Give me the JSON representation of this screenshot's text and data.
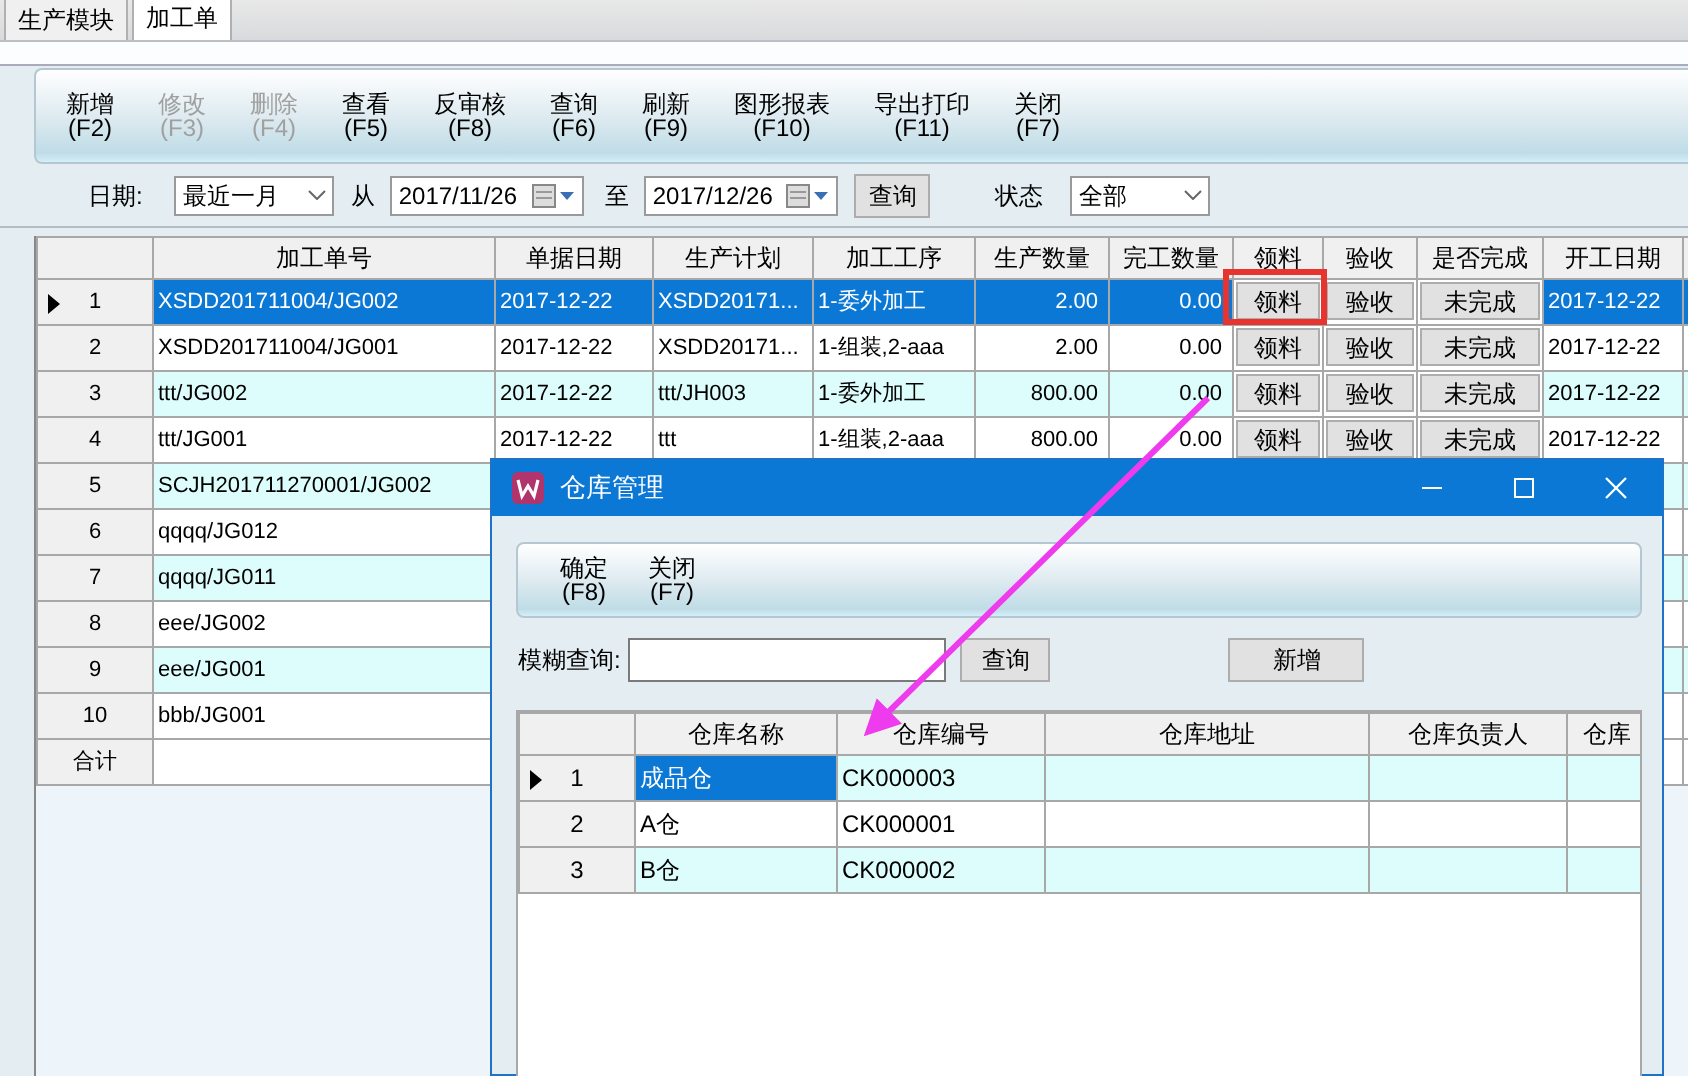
{
  "tabs": [
    {
      "label": "生产模块",
      "selected": false
    },
    {
      "label": "加工单",
      "selected": true
    }
  ],
  "toolbar": [
    {
      "label": "新增",
      "key": "(F2)",
      "disabled": false
    },
    {
      "label": "修改",
      "key": "(F3)",
      "disabled": true
    },
    {
      "label": "删除",
      "key": "(F4)",
      "disabled": true
    },
    {
      "label": "查看",
      "key": "(F5)",
      "disabled": false
    },
    {
      "label": "反审核",
      "key": "(F8)",
      "disabled": false
    },
    {
      "label": "查询",
      "key": "(F6)",
      "disabled": false
    },
    {
      "label": "刷新",
      "key": "(F9)",
      "disabled": false
    },
    {
      "label": "图形报表",
      "key": "(F10)",
      "disabled": false
    },
    {
      "label": "导出打印",
      "key": "(F11)",
      "disabled": false
    },
    {
      "label": "关闭",
      "key": "(F7)",
      "disabled": false
    }
  ],
  "filter": {
    "date_label": "日期:",
    "period": "最近一月",
    "from_label": "从",
    "from": "2017/11/26",
    "to_label": "至",
    "to": "2017/12/26",
    "query_button": "查询",
    "status_label": "状态",
    "status": "全部"
  },
  "table": {
    "columns": [
      {
        "label": "加工单号",
        "kind": "text"
      },
      {
        "label": "单据日期",
        "kind": "text"
      },
      {
        "label": "生产计划",
        "kind": "text"
      },
      {
        "label": "加工工序",
        "kind": "text"
      },
      {
        "label": "生产数量",
        "kind": "number"
      },
      {
        "label": "完工数量",
        "kind": "number"
      },
      {
        "label": "领料",
        "kind": "button"
      },
      {
        "label": "验收",
        "kind": "button"
      },
      {
        "label": "是否完成",
        "kind": "button"
      },
      {
        "label": "开工日期",
        "kind": "text"
      }
    ],
    "rows": [
      {
        "index": "1",
        "selected": true,
        "cells": [
          "XSDD201711004/JG002",
          "2017-12-22",
          "XSDD20171...",
          "1-委外加工",
          "2.00",
          "0.00",
          "领料",
          "验收",
          "未完成",
          "2017-12-22"
        ]
      },
      {
        "index": "2",
        "selected": false,
        "cells": [
          "XSDD201711004/JG001",
          "2017-12-22",
          "XSDD20171...",
          "1-组装,2-aaa",
          "2.00",
          "0.00",
          "领料",
          "验收",
          "未完成",
          "2017-12-22"
        ]
      },
      {
        "index": "3",
        "selected": false,
        "cells": [
          "ttt/JG002",
          "2017-12-22",
          "ttt/JH003",
          "1-委外加工",
          "800.00",
          "0.00",
          "领料",
          "验收",
          "未完成",
          "2017-12-22"
        ]
      },
      {
        "index": "4",
        "selected": false,
        "cells": [
          "ttt/JG001",
          "2017-12-22",
          "ttt",
          "1-组装,2-aaa",
          "800.00",
          "0.00",
          "领料",
          "验收",
          "未完成",
          "2017-12-22"
        ]
      },
      {
        "index": "5",
        "selected": false,
        "cells": [
          "SCJH201711270001/JG002"
        ]
      },
      {
        "index": "6",
        "selected": false,
        "cells": [
          "qqqq/JG012"
        ]
      },
      {
        "index": "7",
        "selected": false,
        "cells": [
          "qqqq/JG011"
        ]
      },
      {
        "index": "8",
        "selected": false,
        "cells": [
          "eee/JG002"
        ]
      },
      {
        "index": "9",
        "selected": false,
        "cells": [
          "eee/JG001"
        ]
      },
      {
        "index": "10",
        "selected": false,
        "cells": [
          "bbb/JG001"
        ]
      }
    ],
    "footer": "合计"
  },
  "dialog": {
    "title": "仓库管理",
    "toolbar": [
      {
        "label": "确定",
        "key": "(F8)"
      },
      {
        "label": "关闭",
        "key": "(F7)"
      }
    ],
    "search_label": "模糊查询:",
    "query_button": "查询",
    "add_button": "新增",
    "table": {
      "columns": [
        "仓库名称",
        "仓库编号",
        "仓库地址",
        "仓库负责人",
        "仓库"
      ],
      "rows": [
        {
          "index": "1",
          "selected": true,
          "cells": [
            "成品仓",
            "CK000003"
          ]
        },
        {
          "index": "2",
          "selected": false,
          "cells": [
            "A仓",
            "CK000001"
          ]
        },
        {
          "index": "3",
          "selected": false,
          "cells": [
            "B仓",
            "CK000002"
          ]
        }
      ]
    }
  }
}
